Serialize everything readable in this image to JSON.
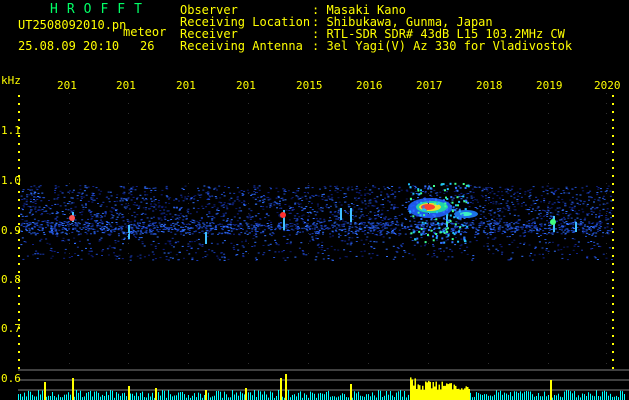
{
  "app": {
    "logo": "HROFFT",
    "file": "UT2508092010.pn",
    "mode": "meteor",
    "datetime": "25.08.09 20:10",
    "count": "26"
  },
  "info": {
    "observer_label": "Observer",
    "observer_value": ": Masaki Kano",
    "location_label": "Receiving Location",
    "location_value": ": Shibukawa, Gunma, Japan",
    "receiver_label": "Receiver",
    "receiver_value": ": RTL-SDR SDR# 43dB L15 103.2MHz CW",
    "antenna_label": "Receiving Antenna",
    "antenna_value": ": 3el Yagi(V) Az 330 for Vladivostok"
  },
  "axes": {
    "y_unit": "kHz",
    "y_ticks": [
      "1.1",
      "1.0",
      "0.9",
      "0.8",
      "0.7",
      "0.6"
    ],
    "x_ticks": [
      "201",
      "201",
      "201",
      "201",
      "2015",
      "2016",
      "2017",
      "2018",
      "2019",
      "2020"
    ]
  },
  "colors": {
    "background": "#000000",
    "text": "#ffff00",
    "logo": "#00ff66",
    "grid": "#808080",
    "bar_level": "#00ffff",
    "bar_peak": "#ffff00"
  }
}
